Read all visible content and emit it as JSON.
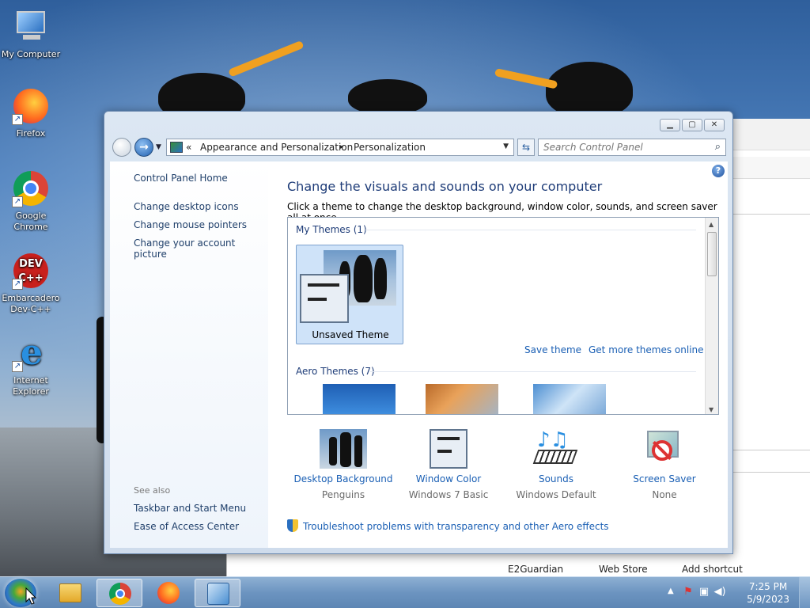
{
  "desktop": {
    "icons": [
      {
        "label": "My Computer"
      },
      {
        "label": "Firefox"
      },
      {
        "label": "Google Chrome"
      },
      {
        "label": "Embarcadero Dev-C++"
      },
      {
        "label": "Internet Explorer"
      }
    ]
  },
  "background_window": {
    "bookmarks": [
      "E2Guardian",
      "Web Store",
      "Add shortcut"
    ]
  },
  "window": {
    "address": {
      "chevron": "«",
      "crumbs": [
        "Appearance and Personalization",
        "Personalization"
      ],
      "separator": "▸"
    },
    "search_placeholder": "Search Control Panel",
    "left_links": [
      "Control Panel Home",
      "Change desktop icons",
      "Change mouse pointers",
      "Change your account picture"
    ],
    "see_also_label": "See also",
    "see_also_links": [
      "Taskbar and Start Menu",
      "Ease of Access Center"
    ],
    "title": "Change the visuals and sounds on your computer",
    "subtitle": "Click a theme to change the desktop background, window color, sounds, and screen saver all at once.",
    "my_themes_header": "My Themes (1)",
    "selected_theme_label": "Unsaved Theme",
    "save_theme": "Save theme",
    "get_more_themes": "Get more themes online",
    "aero_themes_header": "Aero Themes (7)",
    "bottom_items": [
      {
        "title": "Desktop Background",
        "value": "Penguins"
      },
      {
        "title": "Window Color",
        "value": "Windows 7 Basic"
      },
      {
        "title": "Sounds",
        "value": "Windows Default"
      },
      {
        "title": "Screen Saver",
        "value": "None"
      }
    ],
    "troubleshoot_link": "Troubleshoot problems with transparency and other Aero effects"
  },
  "taskbar": {
    "apps": [
      "Windows Explorer",
      "Google Chrome",
      "Firefox",
      "Control Panel"
    ],
    "time": "7:25 PM",
    "date": "5/9/2023"
  },
  "colors": {
    "link": "#1a5fb4",
    "title": "#1e3c78",
    "taskbar": "#6c94c0"
  }
}
